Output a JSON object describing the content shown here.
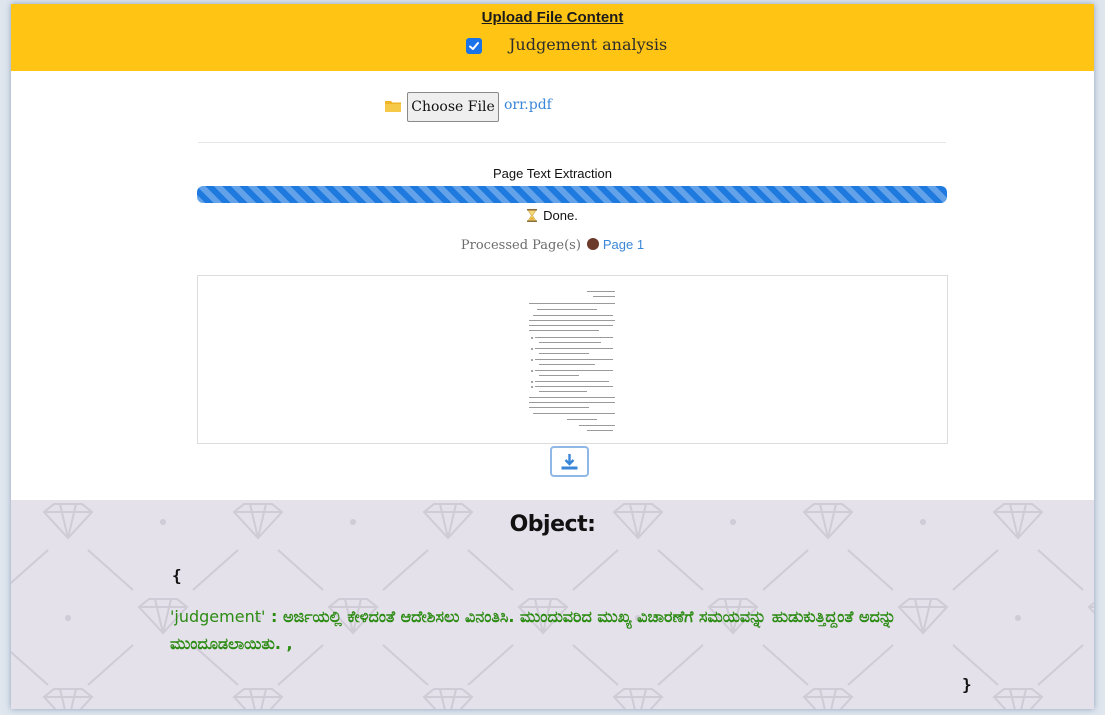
{
  "header": {
    "title": "Upload File Content",
    "checkbox_label": "Judgement analysis",
    "checkbox_checked": true,
    "accent_color": "#ffc414"
  },
  "file_input": {
    "button_label": "Choose File",
    "file_name": "orr.pdf"
  },
  "progress": {
    "title": "Page Text Extraction",
    "value_percent": 100,
    "status": "Done.",
    "processed_label": "Processed Page(s)",
    "page_link": "Page 1",
    "bar_color": "#1f7ae0"
  },
  "download": {
    "icon": "download-icon"
  },
  "object_panel": {
    "title": "Object:",
    "open_brace": "{",
    "close_brace": "}",
    "key": "'judgement'",
    "separator": " : ",
    "value": "ಅರ್ಜಿಯಲ್ಲಿ ಕೇಳಿದಂತೆ ಆದೇಶಿಸಲು ವಿನಂತಿಸಿ. ಮುಂದುವರಿದ ಮುಖ್ಯ ವಿಚಾರಣೆಗೆ ಸಮಯವನ್ನು ಹುಡುಕುತ್ತಿದ್ದಂತೆ ಅದನ್ನು ಮುಂದೂಡಲಾಯಿತು. ,",
    "text_color": "#2c8b13"
  }
}
